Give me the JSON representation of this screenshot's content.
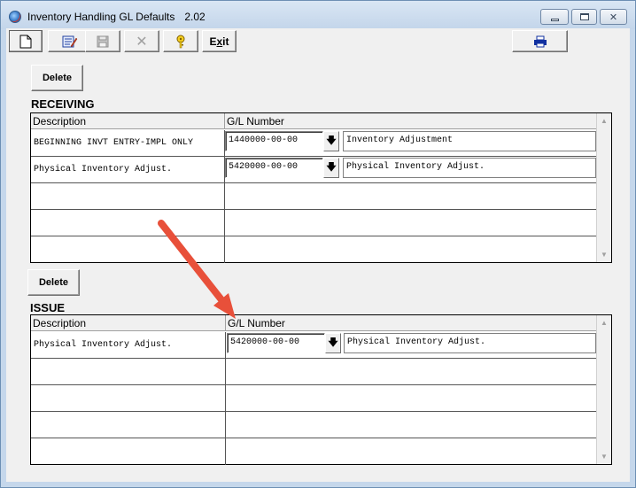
{
  "window": {
    "title": "Inventory Handling GL Defaults",
    "version": "2.02"
  },
  "toolbar": {
    "new_icon": "new-document-icon",
    "edit_icon": "edit-icon",
    "save_icon": "save-icon",
    "cancel_icon": "cancel-x-icon",
    "help_icon": "help-key-icon",
    "exit_label_prefix": "E",
    "exit_label_hot": "x",
    "exit_label_suffix": "it",
    "print_icon": "printer-icon"
  },
  "receiving": {
    "delete_label": "Delete",
    "section_label": "RECEIVING",
    "columns": [
      "Description",
      "G/L Number"
    ],
    "rows": [
      {
        "description": "BEGINNING INVT ENTRY-IMPL ONLY",
        "gl_number": "1440000-00-00",
        "gl_description": "Inventory Adjustment"
      },
      {
        "description": "Physical Inventory Adjust.",
        "gl_number": "5420000-00-00",
        "gl_description": "Physical Inventory Adjust."
      }
    ]
  },
  "issue": {
    "delete_label": "Delete",
    "section_label": "ISSUE",
    "columns": [
      "Description",
      "G/L Number"
    ],
    "rows": [
      {
        "description": "Physical Inventory Adjust.",
        "gl_number": "5420000-00-00",
        "gl_description": "Physical Inventory Adjust."
      }
    ]
  },
  "colors": {
    "annotation_arrow": "#e8503a",
    "frame": "#c5d7eb"
  }
}
